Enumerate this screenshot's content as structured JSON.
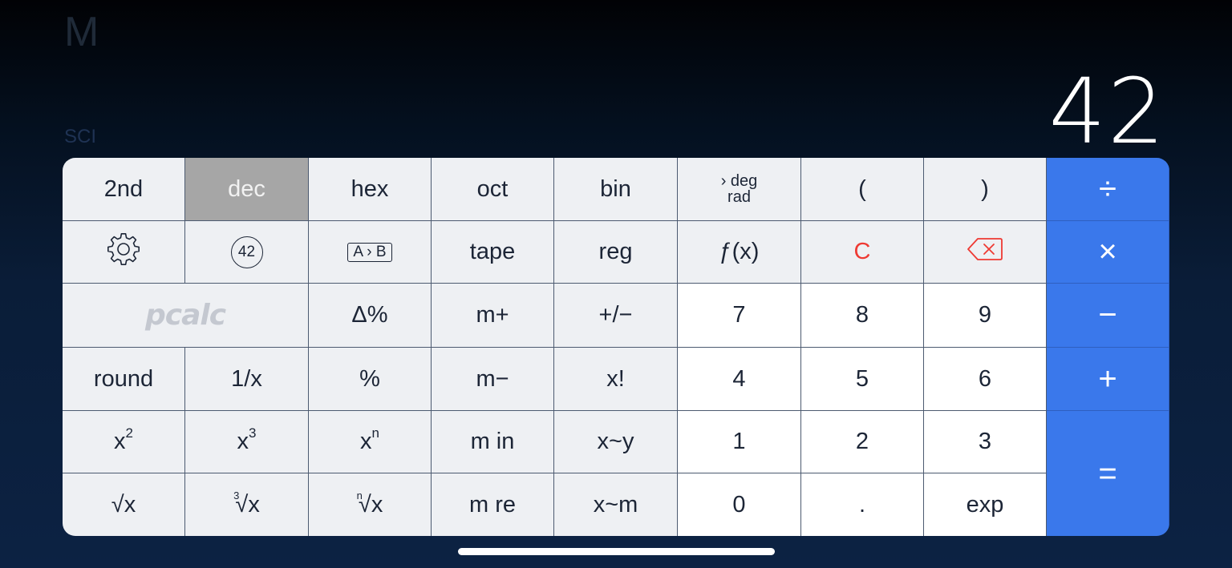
{
  "status": {
    "memory": "M",
    "mode": "SCI"
  },
  "display": {
    "value": "42"
  },
  "keys": {
    "second": "2nd",
    "dec": "dec",
    "hex": "hex",
    "oct": "oct",
    "bin": "bin",
    "deg": "deg",
    "rad": "rad",
    "deg_arrow": "›",
    "paren_open": "(",
    "paren_close": ")",
    "divide": "÷",
    "constant_badge": "42",
    "ab_a": "A",
    "ab_arrow": "›",
    "ab_b": "B",
    "tape": "tape",
    "reg": "reg",
    "fx": "ƒ(x)",
    "clear": "C",
    "multiply": "×",
    "logo": "pcalc",
    "delta_pct": "Δ%",
    "m_plus": "m+",
    "plus_minus": "+/−",
    "n7": "7",
    "n8": "8",
    "n9": "9",
    "minus": "−",
    "round": "round",
    "reciprocal": "1/x",
    "percent": "%",
    "m_minus": "m−",
    "factorial": "x!",
    "n4": "4",
    "n5": "5",
    "n6": "6",
    "plus": "+",
    "x": "x",
    "sq_exp": "2",
    "cube_exp": "3",
    "n_exp": "n",
    "m_in": "m in",
    "x_swap_y": "x~y",
    "n1": "1",
    "n2": "2",
    "n3": "3",
    "equals": "=",
    "root_sign": "√",
    "cbrt_index": "3",
    "nrt_index": "n",
    "m_re": "m re",
    "x_swap_m": "x~m",
    "n0": "0",
    "decimal": ".",
    "exp": "exp"
  },
  "icons": {
    "settings": "gear-icon",
    "backspace": "backspace-icon"
  },
  "colors": {
    "operator_key": "#3a78eb",
    "function_key": "#eef0f3",
    "number_key": "#ffffff",
    "active_key": "#a6a6a6",
    "clear_text": "#ee3a33"
  }
}
